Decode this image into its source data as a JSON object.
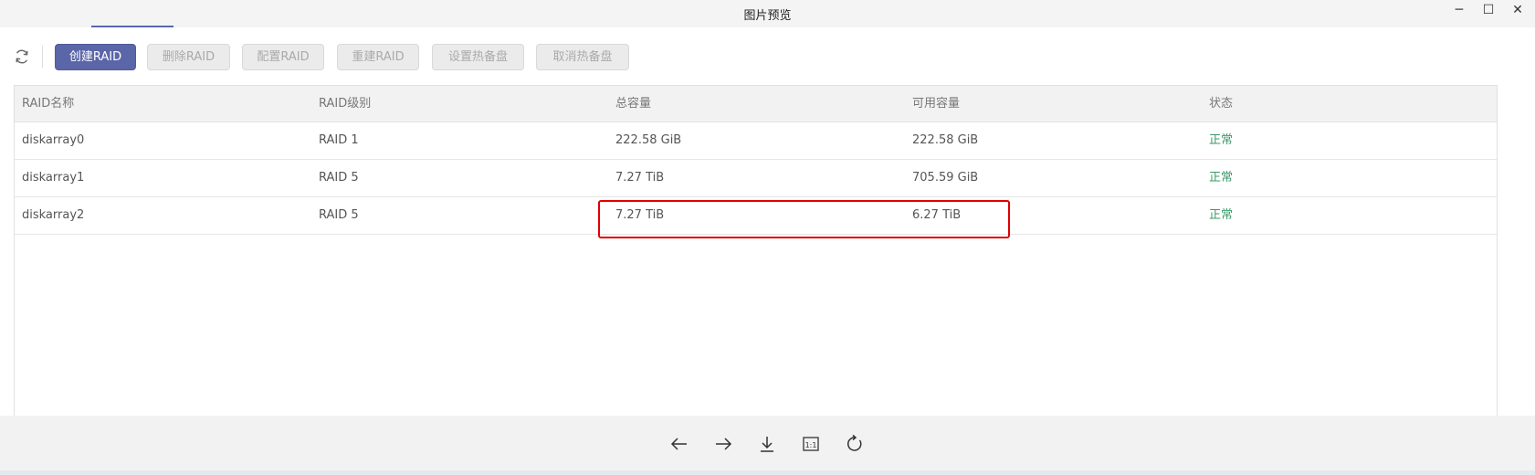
{
  "window": {
    "title": "图片预览",
    "controls": {
      "minimize": "─",
      "maximize": "☐",
      "close": "✕"
    }
  },
  "toolbar": {
    "refresh_icon": "refresh-icon",
    "buttons": [
      {
        "label": "创建RAID",
        "enabled": true
      },
      {
        "label": "删除RAID",
        "enabled": false
      },
      {
        "label": "配置RAID",
        "enabled": false
      },
      {
        "label": "重建RAID",
        "enabled": false
      },
      {
        "label": "设置热备盘",
        "enabled": false
      },
      {
        "label": "取消热备盘",
        "enabled": false
      }
    ]
  },
  "table": {
    "columns": [
      "RAID名称",
      "RAID级别",
      "总容量",
      "可用容量",
      "状态"
    ],
    "rows": [
      {
        "name": "diskarray0",
        "level": "RAID 1",
        "total": "222.58 GiB",
        "available": "222.58 GiB",
        "status": "正常"
      },
      {
        "name": "diskarray1",
        "level": "RAID 5",
        "total": "7.27 TiB",
        "available": "705.59 GiB",
        "status": "正常"
      },
      {
        "name": "diskarray2",
        "level": "RAID 5",
        "total": "7.27 TiB",
        "available": "6.27 TiB",
        "status": "正常"
      }
    ]
  },
  "viewer_toolbar": {
    "icons": [
      "arrow-left-icon",
      "arrow-right-icon",
      "download-icon",
      "actual-size-icon",
      "rotate-icon"
    ],
    "actual_size_label": "1:1"
  },
  "colors": {
    "primary": "#5b66a8",
    "status_ok": "#3a9a6a",
    "highlight": "#e00000"
  }
}
